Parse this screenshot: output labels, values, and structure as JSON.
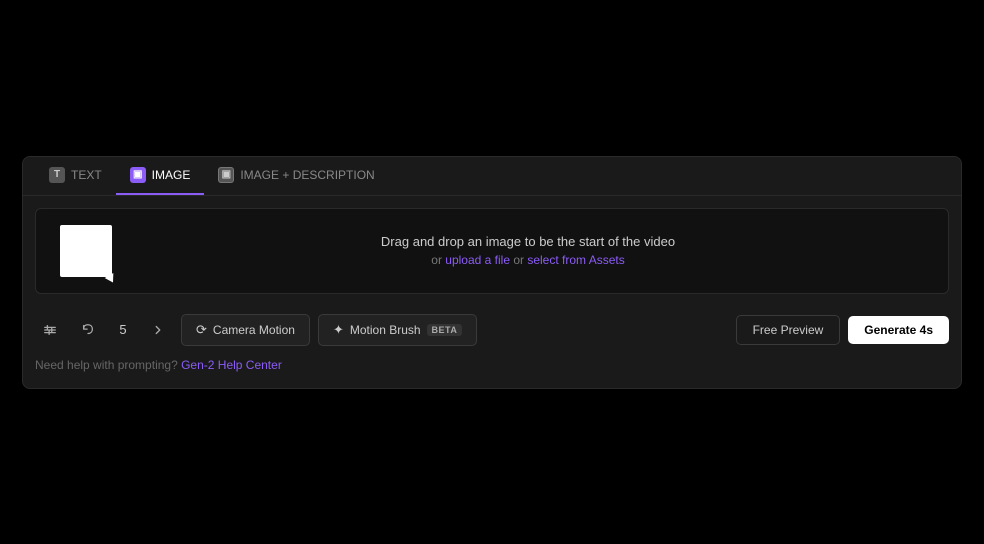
{
  "tabs": {
    "items": [
      {
        "id": "text",
        "label": "TEXT",
        "icon_label": "T",
        "icon_type": "text-icon",
        "active": false
      },
      {
        "id": "image",
        "label": "IMAGE",
        "icon_label": "▣",
        "icon_type": "image-icon",
        "active": true
      },
      {
        "id": "image-desc",
        "label": "IMAGE + DESCRIPTION",
        "icon_label": "▣",
        "icon_type": "image-desc-icon",
        "active": false
      }
    ]
  },
  "drop_area": {
    "main_text": "Drag and drop an image to be the start of the video",
    "sub_text_prefix": "or ",
    "upload_link": "upload a file",
    "sub_text_mid": " or ",
    "assets_link": "select from Assets"
  },
  "toolbar": {
    "number": "5",
    "camera_motion_label": "Camera Motion",
    "motion_brush_label": "Motion Brush",
    "motion_brush_badge": "BETA",
    "free_preview_label": "Free Preview",
    "generate_label": "Generate 4s"
  },
  "help": {
    "prefix": "Need help with prompting? ",
    "link_text": "Gen-2 Help Center"
  },
  "colors": {
    "accent": "#8b5cf6",
    "bg_main": "#000000",
    "bg_panel": "#1a1a1a",
    "bg_dark": "#111111"
  }
}
